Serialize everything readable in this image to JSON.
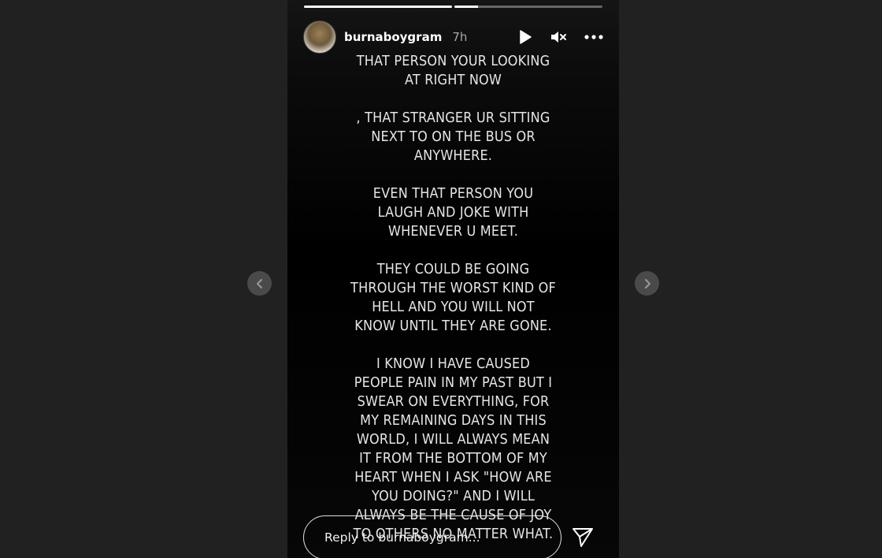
{
  "story": {
    "username": "burnaboygram",
    "time": "7h",
    "progress": [
      1.0,
      0.16
    ],
    "text": "THAT PERSON YOUR LOOKING\nAT RIGHT NOW\n\n, THAT STRANGER UR SITTING\nNEXT TO ON THE BUS OR\nANYWHERE.\n\nEVEN THAT PERSON YOU\nLAUGH AND JOKE WITH\nWHENEVER U MEET.\n\nTHEY COULD BE GOING\nTHROUGH THE WORST KIND OF\nHELL AND YOU WILL NOT\nKNOW UNTIL THEY ARE GONE.\n\nI KNOW I HAVE CAUSED\nPEOPLE PAIN IN MY PAST BUT I\nSWEAR ON EVERYTHING, FOR\nMY REMAINING DAYS IN THIS\nWORLD, I WILL ALWAYS MEAN\nIT FROM THE BOTTOM OF MY\nHEART WHEN I ASK \"HOW ARE\nYOU DOING?\" AND I WILL\nALWAYS BE THE CAUSE OF JOY\nTO OTHERS NO MATTER WHAT."
  },
  "controls": {
    "play_icon": "play-icon",
    "mute_icon": "muted-speaker-icon",
    "more_icon": "more-options-icon"
  },
  "reply": {
    "placeholder": "Reply to burnaboygram..."
  },
  "icons": {
    "send": "send-icon",
    "prev": "chevron-left-icon",
    "next": "chevron-right-icon"
  },
  "colors": {
    "page_background": "#212121",
    "story_background": "#000000",
    "nav_button": "#4a4a4a"
  }
}
